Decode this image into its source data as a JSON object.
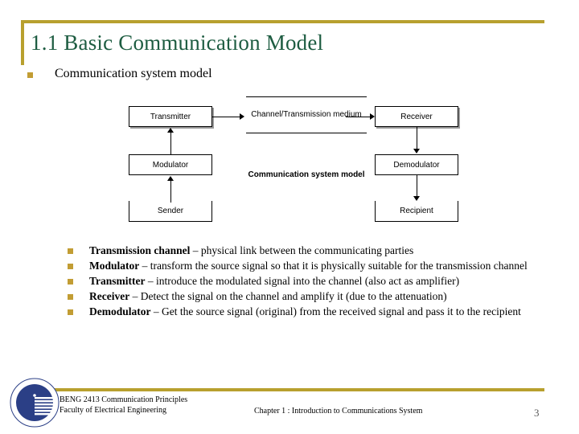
{
  "slide": {
    "title": "1.1 Basic Communication Model",
    "accent_color": "#b8a02e",
    "title_color": "#1d5c41",
    "bullet_color": "#c29d34"
  },
  "main_bullet": {
    "text": "Communication system model"
  },
  "diagram": {
    "caption": "Communication system model",
    "boxes": {
      "transmitter": "Transmitter",
      "modulator": "Modulator",
      "sender": "Sender",
      "channel": "Channel/Transmission medium",
      "receiver": "Receiver",
      "demodulator": "Demodulator",
      "recipient": "Recipient"
    }
  },
  "definitions": [
    {
      "term": "Transmission channel",
      "dash": " – ",
      "description": "physical link between the communicating parties"
    },
    {
      "term": "Modulator",
      "dash": " – ",
      "description": "transform the source signal so that it is physically suitable for the transmission channel"
    },
    {
      "term": "Transmitter",
      "dash": " – ",
      "description": "introduce the modulated signal into the channel (also act as amplifier)"
    },
    {
      "term": "Receiver",
      "dash": " – ",
      "description": "Detect the signal on the channel and amplify it (due to the attenuation)"
    },
    {
      "term": "Demodulator",
      "dash": " – ",
      "description": "Get the source signal (original) from the received signal and pass it to the recipient"
    }
  ],
  "footer": {
    "course": "BENG 2413 Communication Principles",
    "faculty": "Faculty of Electrical Engineering",
    "chapter": "Chapter 1 : Introduction to Communications System",
    "page_number": "3"
  }
}
